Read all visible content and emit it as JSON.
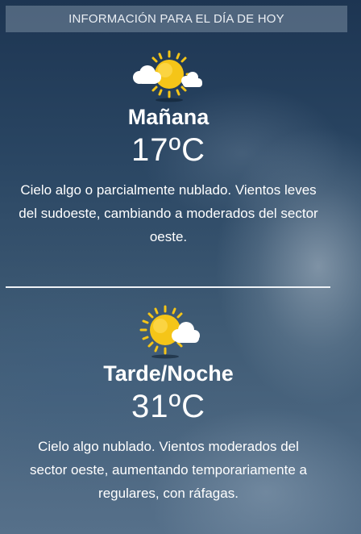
{
  "header": {
    "title": "INFORMACIÓN PARA EL DÍA DE HOY"
  },
  "forecasts": [
    {
      "icon": "sun-behind-cloud-icon",
      "period": "Mañana",
      "temperature": "17ºC",
      "description": "Cielo algo o parcialmente nublado. Vientos leves del sudoeste, cambiando a moderados del sector oeste."
    },
    {
      "icon": "sun-with-small-cloud-icon",
      "period": "Tarde/Noche",
      "temperature": "31ºC",
      "description": "Cielo algo nublado. Vientos moderados del sector oeste, aumentando temporariamente a regulares, con ráfagas."
    }
  ],
  "colors": {
    "sun": "#f5c518",
    "cloud": "#ffffff",
    "background_top": "#1d3552",
    "background_bottom": "#56708a"
  }
}
